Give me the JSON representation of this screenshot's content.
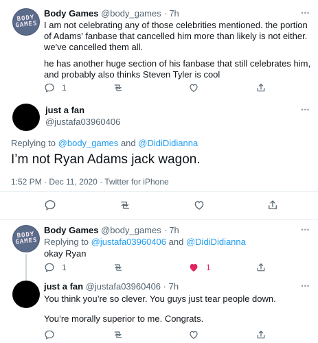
{
  "tweet1": {
    "name": "Body Games",
    "handle": "@body_games",
    "time": "· 7h",
    "avatar_text": "BODY\nGAMES",
    "para1": "I am not celebrating any of those celebrities mentioned. the portion of Adams' fanbase that cancelled him more than likely is not either. we've cancelled them all.",
    "para2": "he has another huge section of his fanbase that still celebrates him, and probably also thinks Steven Tyler is cool",
    "reply_count": "1",
    "more": "•••"
  },
  "main": {
    "name": "just a fan",
    "handle": "@justafa03960406",
    "replying_prefix": "Replying to",
    "replying_to_1": "@body_games",
    "replying_and": "and",
    "replying_to_2": "@DidiDidianna",
    "text": "I’m not Ryan Adams jack wagon.",
    "timestamp": "1:52 PM · Dec 11, 2020 · Twitter for iPhone",
    "more": "•••"
  },
  "tweet3": {
    "name": "Body Games",
    "handle": "@body_games",
    "time": "· 7h",
    "avatar_text": "BODY\nGAMES",
    "replying_prefix": "Replying to",
    "replying_to_1": "@justafa03960406",
    "replying_and": "and",
    "replying_to_2": "@DidiDidianna",
    "text": "okay Ryan",
    "reply_count": "1",
    "like_count": "1",
    "more": "•••"
  },
  "tweet4": {
    "name": "just a fan",
    "handle": "@justafa03960406",
    "time": "· 7h",
    "para1": "You think you’re so clever. You guys just tear people down.",
    "para2": "You’re morally superior to me. Congrats.",
    "more": "•••"
  },
  "colors": {
    "accent": "#1d9bf0",
    "like": "#e0245e",
    "secondary_text": "#536471"
  }
}
